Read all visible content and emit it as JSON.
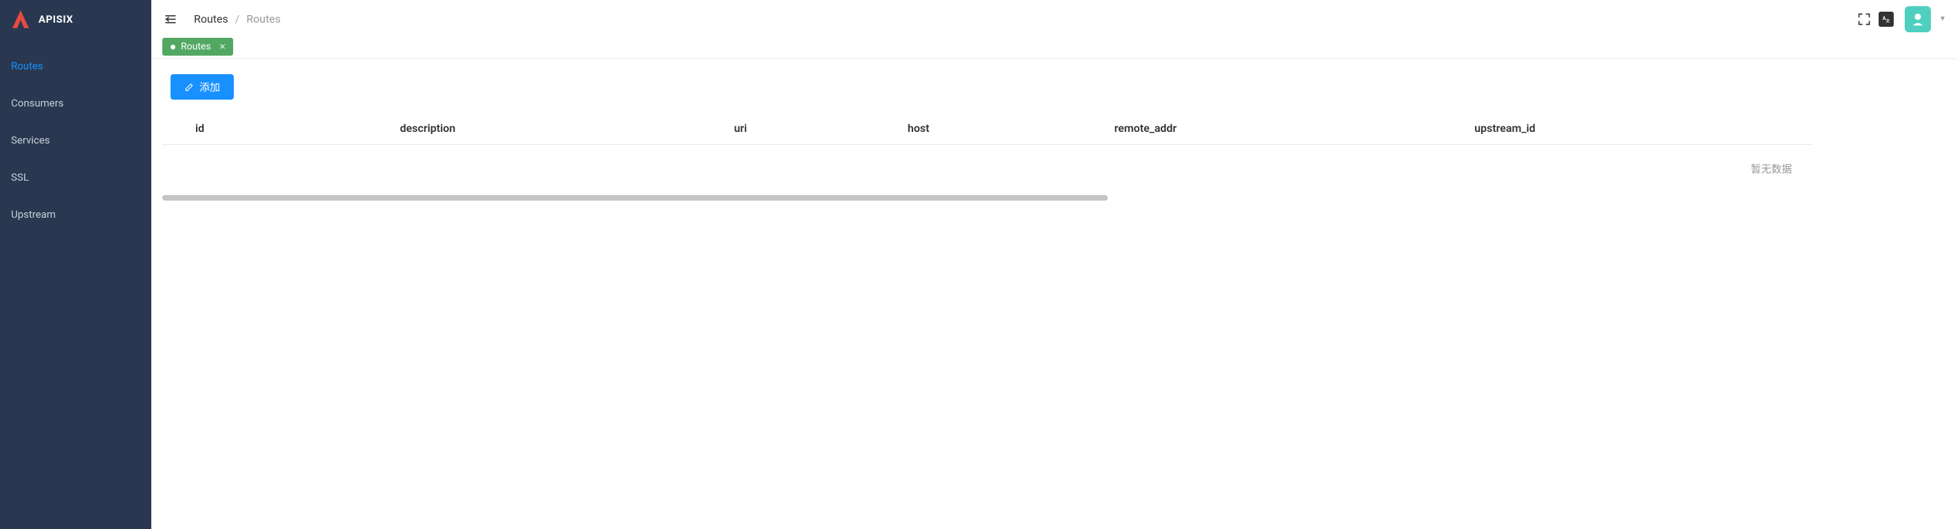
{
  "brand": {
    "name": "APISIX"
  },
  "sidebar": {
    "items": [
      {
        "label": "Routes",
        "active": true
      },
      {
        "label": "Consumers",
        "active": false
      },
      {
        "label": "Services",
        "active": false
      },
      {
        "label": "SSL",
        "active": false
      },
      {
        "label": "Upstream",
        "active": false
      }
    ]
  },
  "breadcrumb": {
    "items": [
      {
        "label": "Routes",
        "current": false
      },
      {
        "label": "Routes",
        "current": true
      }
    ],
    "separator": "/"
  },
  "tabs": [
    {
      "label": "Routes",
      "active": true
    }
  ],
  "toolbar": {
    "add_label": "添加"
  },
  "table": {
    "columns": [
      "id",
      "description",
      "uri",
      "host",
      "remote_addr",
      "upstream_id"
    ],
    "rows": [],
    "empty_text": "暂无数据"
  },
  "header_actions": {
    "fullscreen_icon": "fullscreen-icon",
    "language_icon": "language-icon",
    "avatar_icon": "avatar-icon",
    "dropdown_icon": "caret-down-icon"
  },
  "colors": {
    "sidebar_bg": "#293850",
    "active_link": "#1890ff",
    "tab_bg": "#52a863",
    "avatar_bg": "#4fcfc0",
    "logo_accent": "#e84a3f"
  }
}
